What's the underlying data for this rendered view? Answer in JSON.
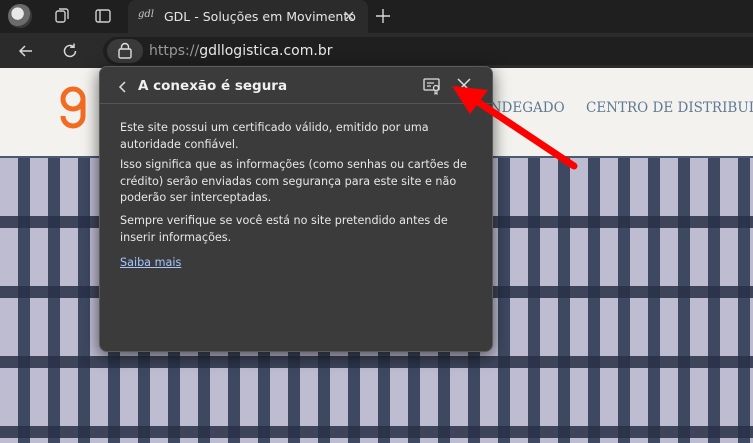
{
  "browser": {
    "tab": {
      "favicon_text": "gdl",
      "title": "GDL - Soluções em Movimento"
    },
    "address": {
      "protocol": "https://",
      "domain": "gdllogistica.com.br"
    }
  },
  "site": {
    "menu": [
      "ANDEGADO",
      "CENTRO DE DISTRIBUIÇ"
    ]
  },
  "popup": {
    "title": "A conexão é segura",
    "p1": "Este site possui um certificado válido, emitido por uma autoridade confiável.",
    "p2": "Isso significa que as informações (como senhas ou cartões de crédito) serão enviadas com segurança para este site e não poderão ser interceptadas.",
    "p3": "Sempre verifique se você está no site pretendido antes de inserir informações.",
    "link": "Saiba mais"
  },
  "colors": {
    "annotation_arrow": "#ff0000",
    "brand_orange": "#f26b21"
  }
}
